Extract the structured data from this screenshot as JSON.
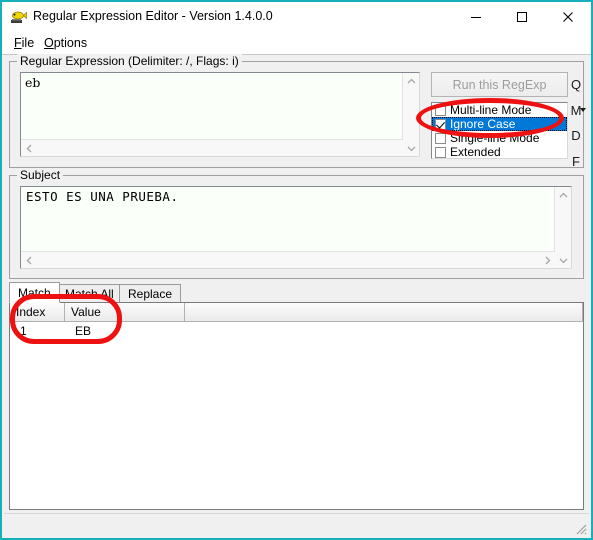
{
  "window": {
    "title": "Regular Expression Editor - Version 1.4.0.0",
    "icon": "app-fish-icon",
    "border_color": "#16b0bd",
    "minimize_label": "–",
    "maximize_label": "□",
    "close_label": "✕"
  },
  "menubar": {
    "items": [
      {
        "label": "File",
        "accel": "F"
      },
      {
        "label": "Options",
        "accel": "O"
      }
    ]
  },
  "regex_group": {
    "title": "Regular Expression (Delimiter: /, Flags: i)",
    "value": "eb",
    "delimiter": "/",
    "flags": "i"
  },
  "run_button": {
    "label": "Run this RegExp",
    "enabled": false
  },
  "flags_list": {
    "selected_index": 1,
    "selection_color": "#0078d7",
    "items": [
      {
        "label": "Multi-line Mode",
        "checked": false
      },
      {
        "label": "Ignore Case",
        "checked": true
      },
      {
        "label": "Single-line Mode",
        "checked": false
      },
      {
        "label": "Extended",
        "checked": false
      }
    ]
  },
  "side_buttons": {
    "items": [
      {
        "label": "Q",
        "name": "quote-button"
      },
      {
        "label": "M",
        "name": "mode-dropdown-button",
        "has_dropdown": true
      },
      {
        "label": "D",
        "name": "delimiter-button"
      },
      {
        "label": "F",
        "name": "flags-button"
      }
    ]
  },
  "subject_group": {
    "title": "Subject",
    "value": "ESTO ES UNA PRUEBA."
  },
  "tabs": {
    "active": "Match",
    "items": [
      {
        "label": "Match"
      },
      {
        "label": "Match All"
      },
      {
        "label": "Replace"
      }
    ]
  },
  "results": {
    "columns": [
      "Index",
      "Value"
    ],
    "rows": [
      {
        "index": "1",
        "value": "EB"
      }
    ]
  },
  "statusbar": {
    "text": ""
  },
  "annotations": {
    "color": "#ee1111",
    "shapes": [
      {
        "name": "highlight-ignore-case",
        "target": "flags-list-ignore-case"
      },
      {
        "name": "highlight-match-result",
        "target": "results-grid"
      }
    ]
  },
  "scrollbars": {
    "up": "⌃",
    "down": "⌄",
    "left": "‹",
    "right": "›"
  }
}
